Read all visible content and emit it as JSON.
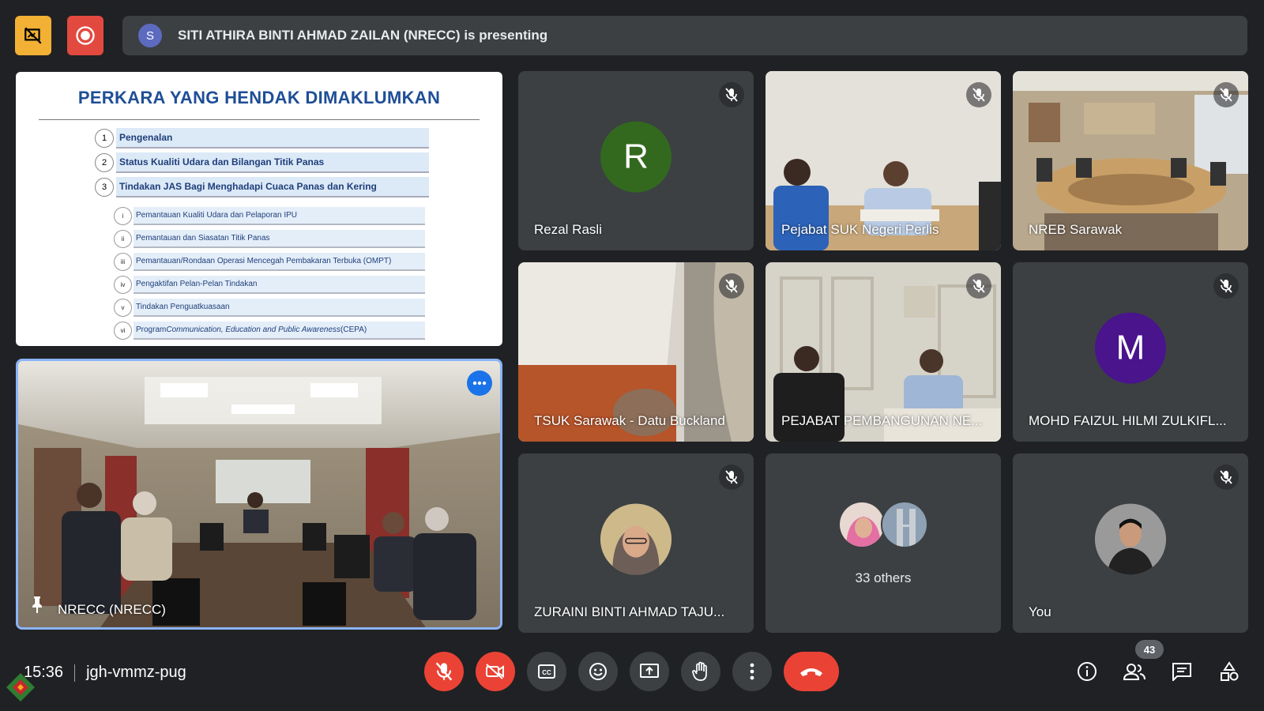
{
  "presenter": {
    "initial": "S",
    "text": "SITI ATHIRA BINTI AHMAD ZAILAN (NRECC) is presenting"
  },
  "slide": {
    "title": "PERKARA YANG HENDAK DIMAKLUMKAN",
    "main_items": [
      {
        "num": "1",
        "label": "Pengenalan"
      },
      {
        "num": "2",
        "label": "Status Kualiti Udara dan Bilangan Titik Panas"
      },
      {
        "num": "3",
        "label": "Tindakan JAS Bagi Menghadapi Cuaca Panas dan Kering"
      }
    ],
    "sub_items": [
      {
        "num": "i",
        "label": "Pemantauan Kualiti Udara dan Pelaporan IPU"
      },
      {
        "num": "ii",
        "label": "Pemantauan dan Siasatan Titik Panas"
      },
      {
        "num": "iii",
        "label": "Pemantauan/Rondaan Operasi Mencegah Pembakaran Terbuka (OMPT)"
      },
      {
        "num": "iv",
        "label": "Pengaktifan Pelan-Pelan Tindakan"
      },
      {
        "num": "v",
        "label": "Tindakan Penguatkuasaan"
      },
      {
        "num": "vi",
        "label_prefix": "Program ",
        "label_italic": "Communication, Education and Public Awareness",
        "label_suffix": " (CEPA)"
      }
    ]
  },
  "pinned": {
    "name": "NRECC (NRECC)"
  },
  "tiles": [
    {
      "name": "Rezal Rasli",
      "initial": "R",
      "avatar_color": "#33691e"
    },
    {
      "name": "Pejabat SUK Negeri Perlis"
    },
    {
      "name": "NREB Sarawak"
    },
    {
      "name": "TSUK Sarawak - Datu Buckland"
    },
    {
      "name": "PEJABAT PEMBANGUNAN NE..."
    },
    {
      "name": "MOHD FAIZUL HILMI ZULKIFL...",
      "initial": "M",
      "avatar_color": "#4a148c"
    },
    {
      "name": "ZURAINI BINTI AHMAD TAJU..."
    },
    {
      "name": "33 others"
    },
    {
      "name": "You"
    }
  ],
  "bottom": {
    "time": "15:36",
    "meeting_code": "jgh-vmmz-pug",
    "participant_count": "43"
  },
  "colors": {
    "accent_blue": "#8ab4f8",
    "danger_red": "#ea4335",
    "bg": "#202124",
    "tile_bg": "#3c4043"
  }
}
